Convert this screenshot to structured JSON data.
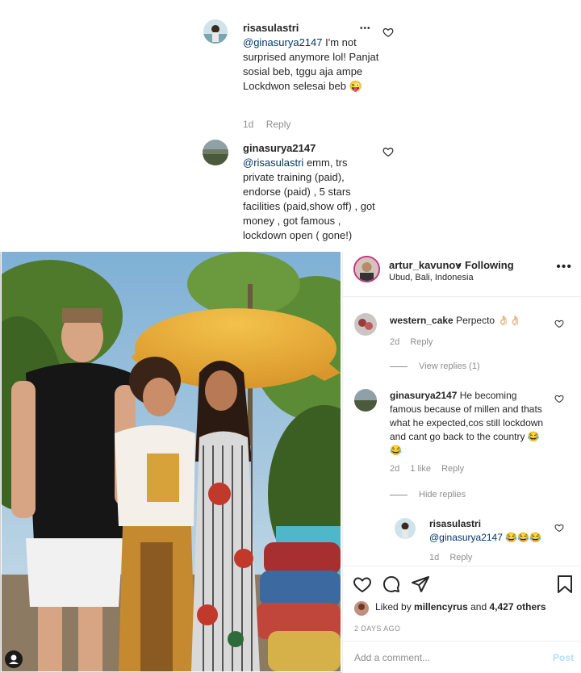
{
  "top_comments": [
    {
      "username": "risasulastri",
      "mention": "@ginasurya2147",
      "text": "I'm not surprised anymore lol! Panjat sosial beb, tggu aja ampe Lockdwon selesai beb 😜",
      "time": "1d",
      "reply_label": "Reply",
      "more_icon": "•••"
    },
    {
      "username": "ginasurya2147",
      "mention": "@risasulastri",
      "text": "emm, trs private training (paid), endorse (paid) , 5 stars facilities (paid,show off) , got money , got famous , lockdown open ( gone!)"
    }
  ],
  "post": {
    "username": "artur_kavunov",
    "separator": "•",
    "follow_status": "Following",
    "location": "Ubud, Bali, Indonesia",
    "more_icon": "•••"
  },
  "comments": [
    {
      "username": "western_cake",
      "text": "Perpecto 👌🏻👌🏻",
      "time": "2d",
      "reply_label": "Reply",
      "replies_toggle": "View replies (1)"
    },
    {
      "username": "ginasurya2147",
      "text": "He becoming famous because of millen and thats what he expected,cos still lockdown and cant go back to the country 😂😂",
      "time": "2d",
      "likes": "1 like",
      "reply_label": "Reply",
      "replies_toggle": "Hide replies"
    }
  ],
  "reply": {
    "username": "risasulastri",
    "mention": "@ginasurya2147",
    "text": "😂😂😂",
    "time": "1d",
    "reply_label": "Reply"
  },
  "likes": {
    "prefix": "Liked by",
    "user": "millencyrus",
    "and": "and",
    "count": "4,427 others"
  },
  "date": "2 DAYS AGO",
  "comment_input": {
    "placeholder": "Add a comment...",
    "post_label": "Post"
  },
  "colors": {
    "link": "#00376b",
    "muted": "#8e8e8e",
    "post_disabled": "#b2dffc"
  }
}
